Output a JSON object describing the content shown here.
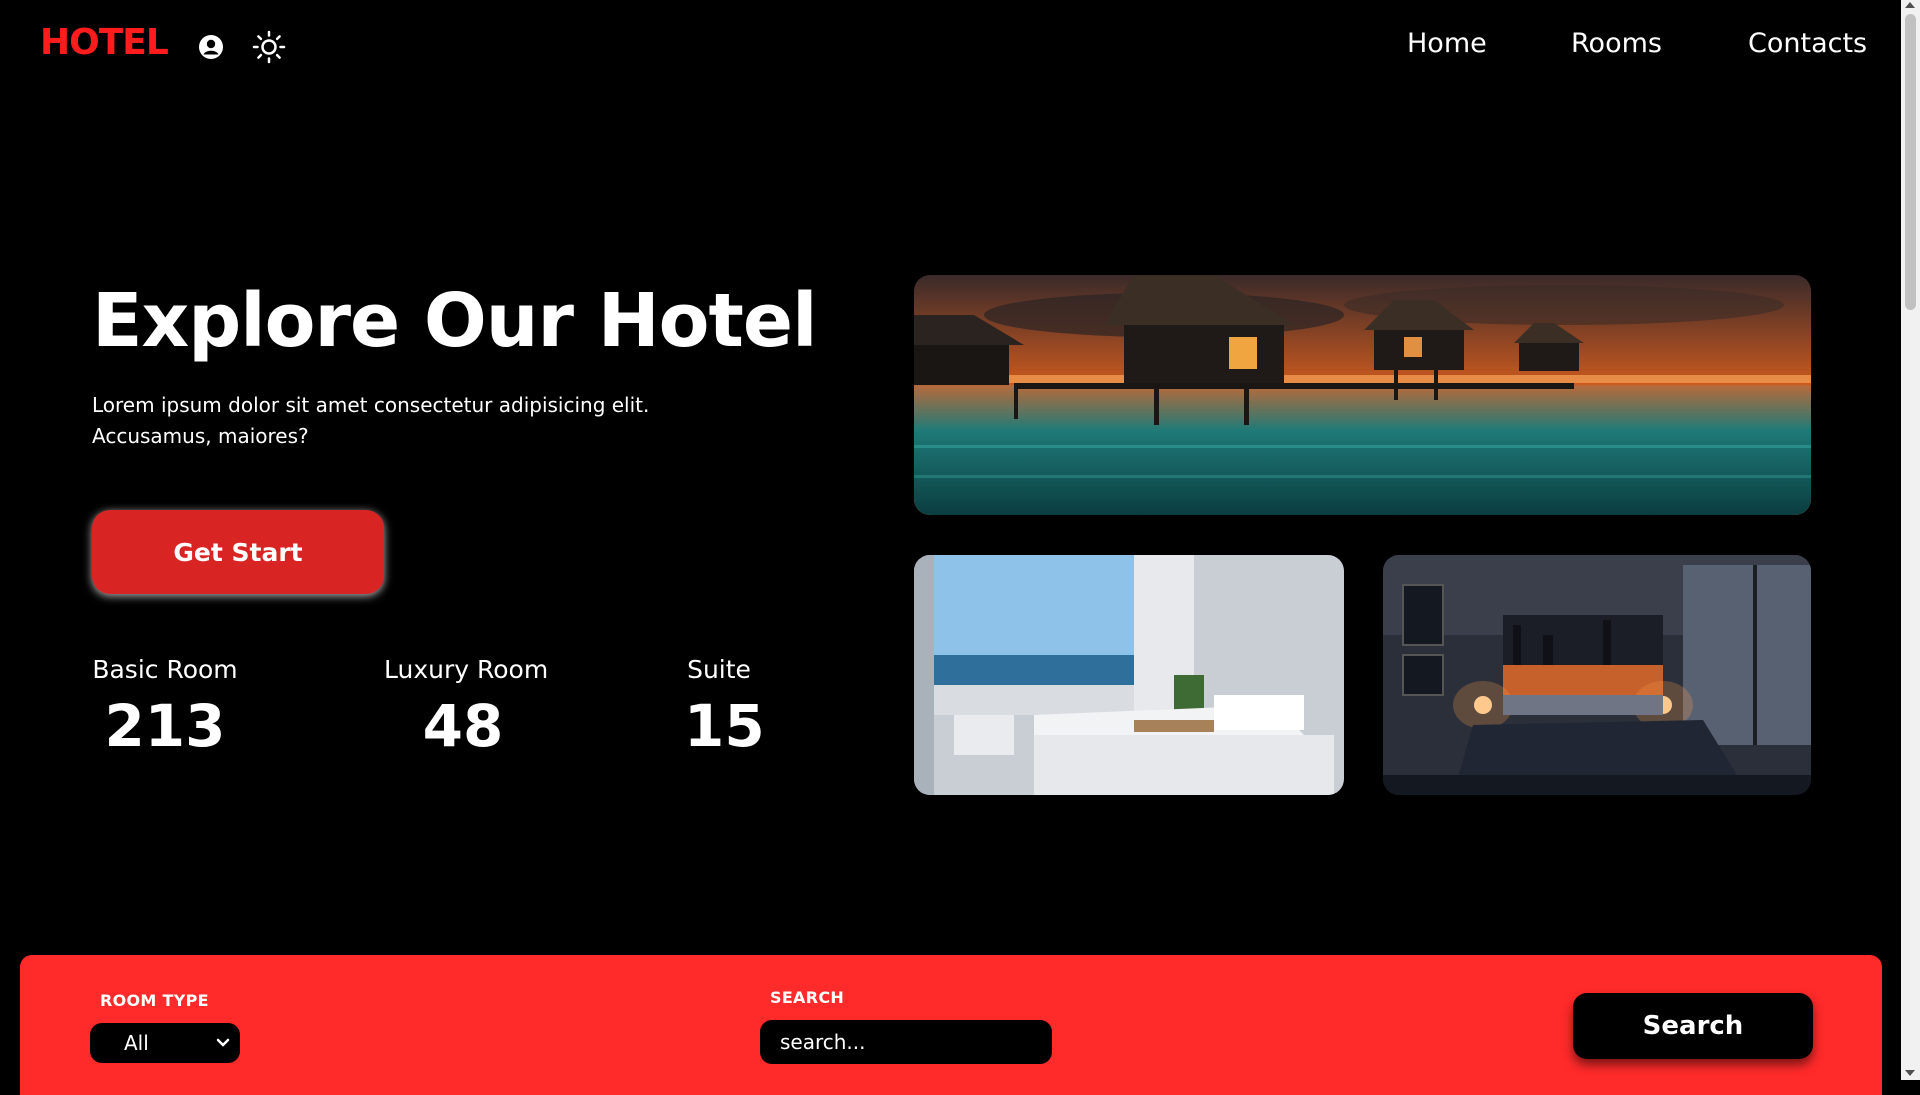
{
  "header": {
    "logo": "HOTEL",
    "icons": [
      "user-circle-icon",
      "sun-icon"
    ],
    "nav": {
      "home": "Home",
      "rooms": "Rooms",
      "contacts": "Contacts"
    }
  },
  "hero": {
    "title": "Explore Our Hotel",
    "description": "Lorem ipsum dolor sit amet consectetur adipisicing elit. Accusamus, maiores?",
    "cta_label": "Get Start"
  },
  "stats": {
    "basic": {
      "label": "Basic Room",
      "value": "213"
    },
    "luxury": {
      "label": "Luxury Room",
      "value": "48"
    },
    "suite": {
      "label": "Suite",
      "value": "15"
    }
  },
  "images": [
    "overwater-bungalows-sunset",
    "bright-ocean-view-bedroom",
    "dark-city-view-bedroom"
  ],
  "search": {
    "room_type_label": "ROOM TYPE",
    "room_type_value": "All",
    "search_label": "SEARCH",
    "search_placeholder": "search...",
    "button_label": "Search"
  },
  "colors": {
    "accent": "#ff2a2a",
    "logo": "#ff1c1c",
    "button": "#d92424",
    "background": "#000000"
  }
}
